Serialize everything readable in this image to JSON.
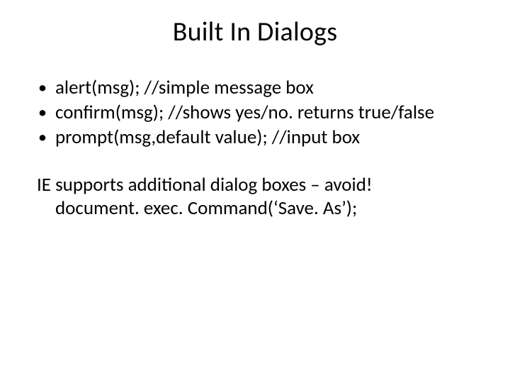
{
  "title": "Built In Dialogs",
  "bullets": [
    "alert(msg); //simple message box",
    "confirm(msg);  //shows yes/no.  returns true/false",
    "prompt(msg,default value);  //input box"
  ],
  "footer": {
    "line1": "IE supports additional dialog boxes – avoid!",
    "line2": "document. exec. Command(‘Save. As’);"
  }
}
